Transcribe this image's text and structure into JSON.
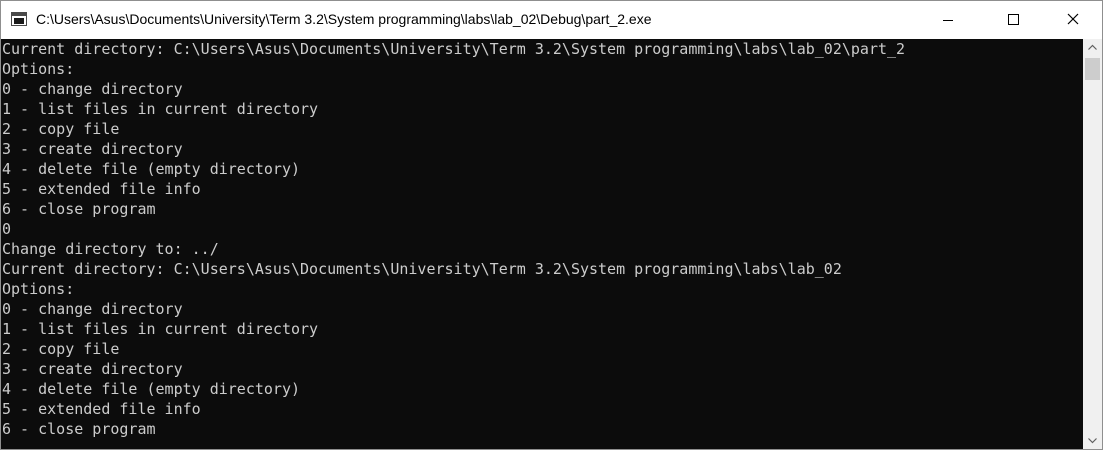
{
  "window": {
    "title": "C:\\Users\\Asus\\Documents\\University\\Term 3.2\\System programming\\labs\\lab_02\\Debug\\part_2.exe"
  },
  "titlebar_icons": {
    "app": "console-window-icon",
    "minimize": "minimize-icon",
    "maximize": "maximize-icon",
    "close": "close-icon"
  },
  "console": {
    "background_color": "#0c0c0c",
    "text_color": "#cccccc",
    "lines": [
      "Current directory: C:\\Users\\Asus\\Documents\\University\\Term 3.2\\System programming\\labs\\lab_02\\part_2",
      "Options:",
      "0 - change directory",
      "1 - list files in current directory",
      "2 - copy file",
      "3 - create directory",
      "4 - delete file (empty directory)",
      "5 - extended file info",
      "6 - close program",
      "0",
      "Change directory to: ../",
      "Current directory: C:\\Users\\Asus\\Documents\\University\\Term 3.2\\System programming\\labs\\lab_02",
      "Options:",
      "0 - change directory",
      "1 - list files in current directory",
      "2 - copy file",
      "3 - create directory",
      "4 - delete file (empty directory)",
      "5 - extended file info",
      "6 - close program"
    ]
  },
  "scrollbar": {
    "up_icon": "scroll-up-arrow-icon",
    "down_icon": "scroll-down-arrow-icon",
    "position_fraction": 0.0
  }
}
